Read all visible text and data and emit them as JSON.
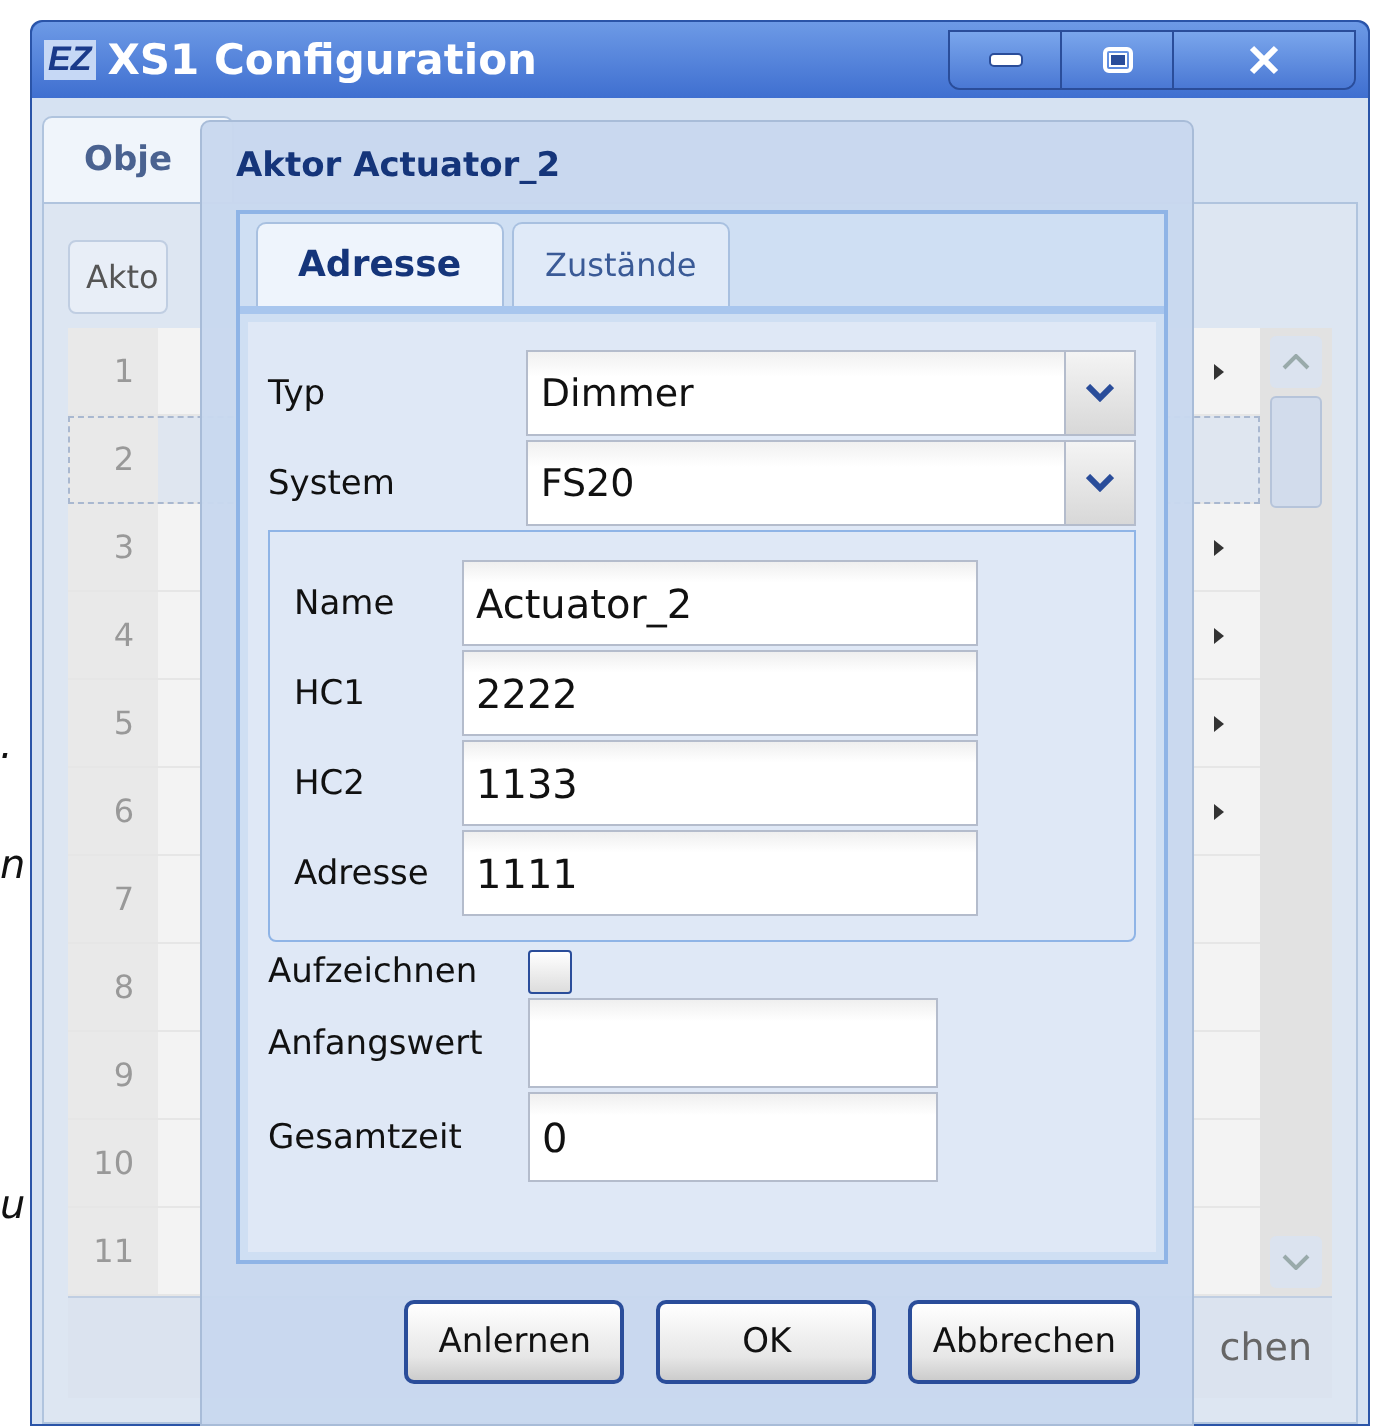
{
  "margin_fragments": [
    ".",
    "n",
    "u"
  ],
  "window": {
    "logo": "EZ",
    "title": "XS1 Configuration"
  },
  "background": {
    "tabs": [
      {
        "label": "Obje",
        "selected": true
      }
    ],
    "toolbar_label": "Akto",
    "rows": [
      {
        "number": "1",
        "selected": false,
        "arrow": true
      },
      {
        "number": "2",
        "selected": true,
        "arrow": false
      },
      {
        "number": "3",
        "selected": false,
        "arrow": true
      },
      {
        "number": "4",
        "selected": false,
        "arrow": true
      },
      {
        "number": "5",
        "selected": false,
        "arrow": true
      },
      {
        "number": "6",
        "selected": false,
        "arrow": true
      },
      {
        "number": "7",
        "selected": false,
        "arrow": false
      },
      {
        "number": "8",
        "selected": false,
        "arrow": false
      },
      {
        "number": "9",
        "selected": false,
        "arrow": false
      },
      {
        "number": "10",
        "selected": false,
        "arrow": false
      },
      {
        "number": "11",
        "selected": false,
        "arrow": false
      }
    ],
    "bottom_text": "chen"
  },
  "dialog": {
    "title": "Aktor Actuator_2",
    "tabs": [
      {
        "label": "Adresse",
        "selected": true
      },
      {
        "label": "Zustände",
        "selected": false
      }
    ],
    "selects": [
      {
        "label": "Typ",
        "value": "Dimmer"
      },
      {
        "label": "System",
        "value": "FS20"
      }
    ],
    "address_fields": [
      {
        "label": "Name",
        "value": "Actuator_2"
      },
      {
        "label": "HC1",
        "value": "2222"
      },
      {
        "label": "HC2",
        "value": "1133"
      },
      {
        "label": "Adresse",
        "value": "1111"
      }
    ],
    "record": {
      "label": "Aufzeichnen",
      "checked": false
    },
    "fields": [
      {
        "label": "Anfangswert"
      },
      {
        "label": "Gesamtzeit",
        "value": "0"
      }
    ],
    "buttons": [
      "Anlernen",
      "OK",
      "Abbrechen"
    ]
  }
}
